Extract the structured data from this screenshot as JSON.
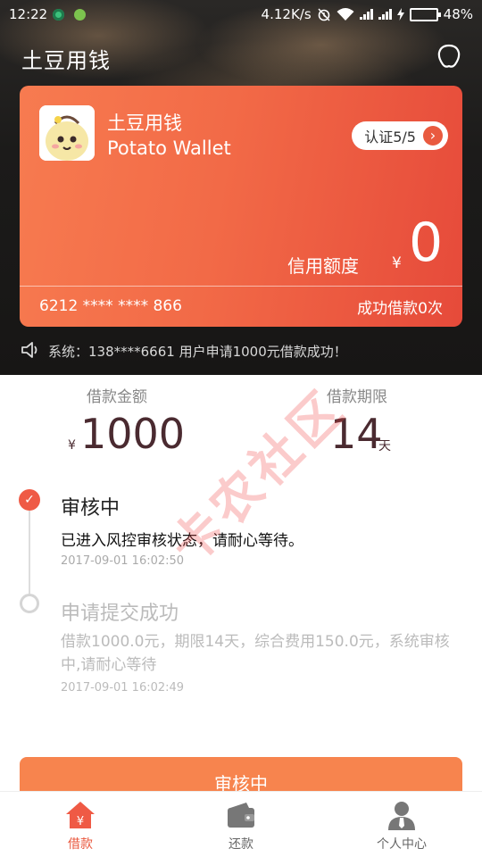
{
  "status_bar": {
    "time": "12:22",
    "network_speed": "4.12K/s",
    "battery": "48%",
    "battery_level": 0.48
  },
  "header": {
    "title": "土豆用钱"
  },
  "card": {
    "name_cn": "土豆用钱",
    "name_en": "Potato Wallet",
    "verify_label": "认证5/5",
    "credit_label": "信用额度",
    "currency": "¥",
    "credit_value": "0",
    "card_number": "6212 **** ****  866",
    "success_count": "成功借款0次"
  },
  "notice": {
    "text": "系统：138****6661 用户申请1000元借款成功！"
  },
  "loan": {
    "amount_label": "借款金额",
    "amount_currency": "¥",
    "amount_value": "1000",
    "period_label": "借款期限",
    "period_value": "14",
    "period_unit": "天"
  },
  "timeline": [
    {
      "title": "审核中",
      "desc": "已进入风控审核状态，请耐心等待。",
      "time": "2017-09-01 16:02:50"
    },
    {
      "title": "申请提交成功",
      "desc": "借款1000.0元，期限14天，综合费用150.0元，系统审核中,请耐心等待",
      "time": "2017-09-01 16:02:49"
    }
  ],
  "watermark": "卡农社区",
  "main_button": "审核中",
  "nav": [
    {
      "label": "借款",
      "icon": "home-yen-icon",
      "active": true
    },
    {
      "label": "还款",
      "icon": "wallet-icon",
      "active": false
    },
    {
      "label": "个人中心",
      "icon": "person-icon",
      "active": false
    }
  ],
  "colors": {
    "accent": "#ef5a45",
    "card_start": "#f77b50",
    "card_end": "#e64a3a",
    "button": "#f7844e"
  }
}
